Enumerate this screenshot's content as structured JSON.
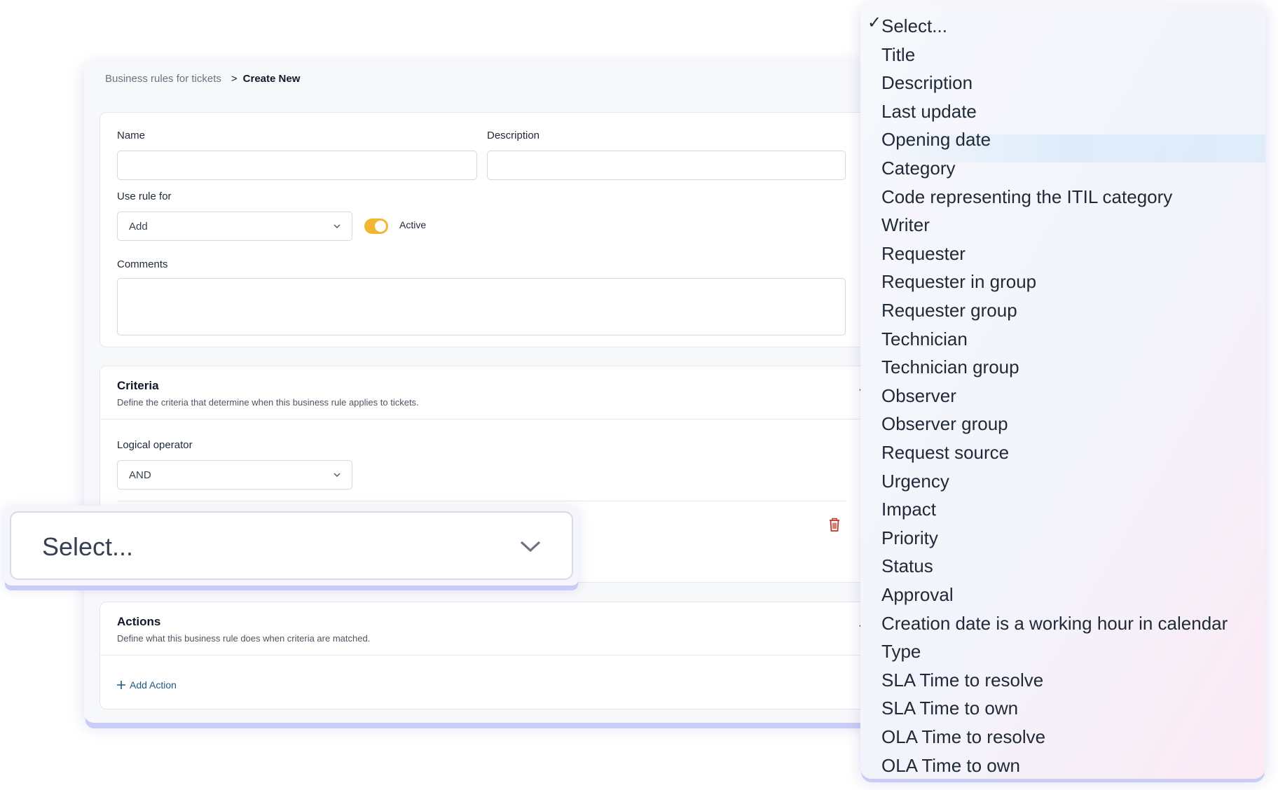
{
  "breadcrumb": {
    "parent": "Business rules for tickets",
    "separator": ">",
    "current": "Create New"
  },
  "form": {
    "name_label": "Name",
    "name_value": "",
    "description_label": "Description",
    "description_value": "",
    "use_rule_for_label": "Use rule for",
    "use_rule_for_value": "Add",
    "active_label": "Active",
    "active_on": true,
    "comments_label": "Comments",
    "comments_value": ""
  },
  "criteria": {
    "title": "Criteria",
    "description": "Define the criteria that determine when this business rule applies to tickets.",
    "logical_operator_label": "Logical operator",
    "logical_operator_value": "AND"
  },
  "actions": {
    "title": "Actions",
    "description": "Define what this business rule does when criteria are matched.",
    "add_action_label": "Add Action"
  },
  "criteria_select": {
    "value": "Select..."
  },
  "dropdown": {
    "checkmark": "✓",
    "selected_index": 0,
    "items": [
      "Select...",
      "Title",
      "Description",
      "Last update",
      "Opening date",
      "Category",
      "Code representing the ITIL category",
      "Writer",
      "Requester",
      "Requester in group",
      "Requester group",
      "Technician",
      "Technician group",
      "Observer",
      "Observer group",
      "Request source",
      "Urgency",
      "Impact",
      "Priority",
      "Status",
      "Approval",
      "Creation date is a working hour in calendar",
      "Type",
      "SLA Time to resolve",
      "SLA Time to own",
      "OLA Time to resolve",
      "OLA Time to own"
    ]
  },
  "colors": {
    "toggle_on": "#f3b632",
    "delete_icon": "#c0392b",
    "link": "#1e5a86"
  }
}
